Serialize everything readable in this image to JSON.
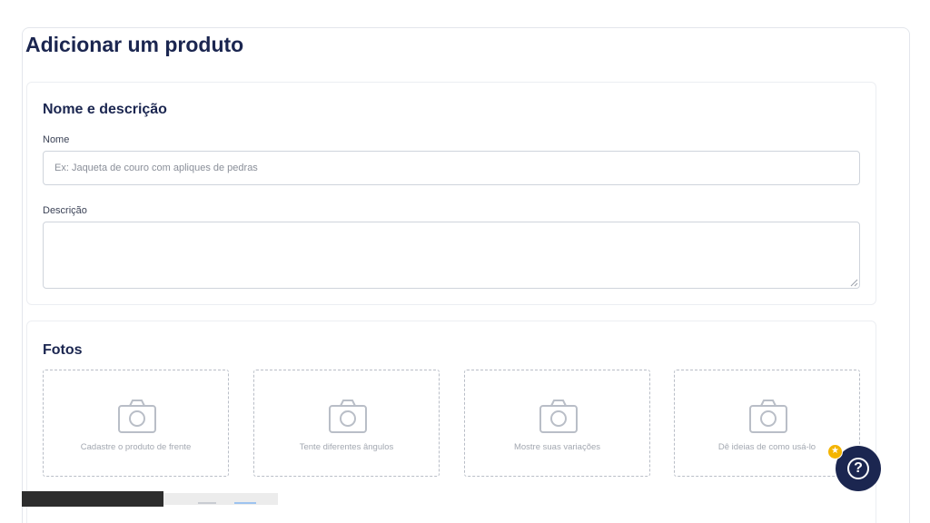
{
  "page": {
    "title": "Adicionar um produto"
  },
  "name_description": {
    "title": "Nome e descrição",
    "name_label": "Nome",
    "name_placeholder": "Ex: Jaqueta de couro com apliques de pedras",
    "name_value": "",
    "description_label": "Descrição",
    "description_value": ""
  },
  "photos": {
    "title": "Fotos",
    "slots": [
      {
        "text": "Cadastre o produto de frente",
        "icon": "camera-icon"
      },
      {
        "text": "Tente diferentes ângulos",
        "icon": "camera-icon"
      },
      {
        "text": "Mostre suas variações",
        "icon": "camera-icon"
      },
      {
        "text": "Dê ideias de como usá-lo",
        "icon": "camera-icon"
      }
    ]
  },
  "help": {
    "symbol": "?",
    "icon": "help-question-icon",
    "badge_icon": "star-icon",
    "badge_symbol": "★"
  },
  "colors": {
    "primary": "#1b2650",
    "border": "#cfd4dc",
    "dashed_border": "#b9bec7",
    "badge": "#f4b400"
  }
}
